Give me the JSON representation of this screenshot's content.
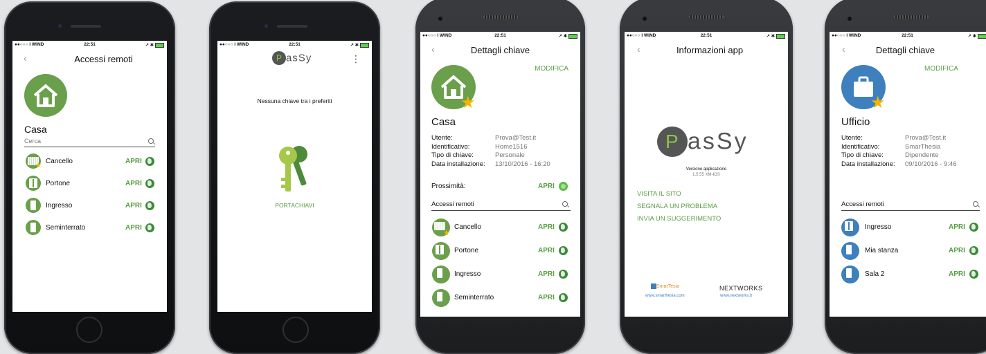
{
  "status": {
    "carrier": "●●○○○ I WIND",
    "wifi": "ᯤ",
    "time": "22:51",
    "icons": "↗ ✱"
  },
  "phone1": {
    "title": "Accessi remoti",
    "key_name": "Casa",
    "search_placeholder": "Cerca",
    "items": [
      {
        "label": "Cancello",
        "action": "APRI"
      },
      {
        "label": "Portone",
        "action": "APRI"
      },
      {
        "label": "Ingresso",
        "action": "APRI"
      },
      {
        "label": "Seminterrato",
        "action": "APRI"
      }
    ]
  },
  "phone2": {
    "logo_text": "asSy",
    "menu": "⋮",
    "empty_message": "Nessuna chiave tra i preferiti",
    "keyring_label": "PORTACHIAVI"
  },
  "phone3": {
    "title": "Dettagli chiave",
    "edit": "MODIFICA",
    "key_name": "Casa",
    "fields": [
      {
        "k": "Utente:",
        "v": "Prova@Test.it"
      },
      {
        "k": "Identificativo:",
        "v": "Home1516"
      },
      {
        "k": "Tipo di chiave:",
        "v": "Personale"
      },
      {
        "k": "Data installazione:",
        "v": "13/10/2016 - 16:20"
      }
    ],
    "proximity_label": "Prossimità:",
    "proximity_action": "APRI",
    "section": "Accessi remoti",
    "items": [
      {
        "label": "Cancello",
        "action": "APRI"
      },
      {
        "label": "Portone",
        "action": "APRI"
      },
      {
        "label": "Ingresso",
        "action": "APRI"
      },
      {
        "label": "Seminterrato",
        "action": "APRI"
      }
    ]
  },
  "phone4": {
    "title": "Informazioni app",
    "logo_text": "asSy",
    "version_label": "Versione applicazione",
    "version": "1.5.55 XM-IOS",
    "links": [
      "VISITA IL SITO",
      "SEGNALA UN PROBLEMA",
      "INVIA UN SUGGERIMENTO"
    ],
    "partner1_name": "SmarTesia",
    "partner1_url": "www.smarthesia.com",
    "partner2_name": "NEXTWORKS",
    "partner2_url": "www.nextworks.it"
  },
  "phone5": {
    "title": "Dettagli chiave",
    "edit": "MODIFICA",
    "key_name": "Ufficio",
    "fields": [
      {
        "k": "Utente:",
        "v": "Prova@Test.it"
      },
      {
        "k": "Identificativo:",
        "v": "SmarThesia"
      },
      {
        "k": "Tipo di chiave:",
        "v": "Dipendente"
      },
      {
        "k": "Data installazione:",
        "v": "09/10/2016 - 9:46"
      }
    ],
    "section": "Accessi remoti",
    "items": [
      {
        "label": "Ingresso",
        "action": "APRI"
      },
      {
        "label": "Mia stanza",
        "action": "APRI"
      },
      {
        "label": "Sala 2",
        "action": "APRI"
      }
    ]
  },
  "colors": {
    "accent": "#5a9e45",
    "blue": "#3d80bd",
    "star": "#f4b400"
  },
  "icons": [
    "home-icon",
    "star-icon",
    "search-icon",
    "door-icon",
    "globe-icon",
    "keys-icon",
    "briefcase-icon",
    "proximity-icon",
    "back-icon",
    "menu-icon"
  ]
}
